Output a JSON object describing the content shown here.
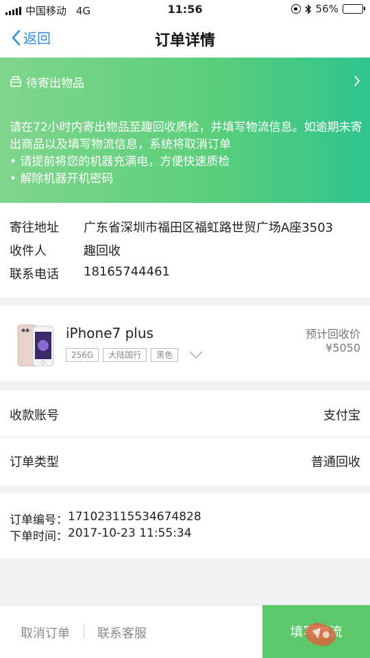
{
  "status_bar": {
    "carrier": "中国移动",
    "network": "4G",
    "time": "11:56",
    "battery": "56%",
    "battery_level": 0.56
  },
  "nav": {
    "back_label": "返回",
    "title": "订单详情"
  },
  "banner": {
    "title": "待寄出物品",
    "notice": "请在72小时内寄出物品至趣回收质检，并填写物流信息。如逾期未寄出商品以及填写物流信息，系统将取消订单",
    "tips": [
      "请提前将您的机器充满电，方便快速质检",
      "解除机器开机密码"
    ]
  },
  "address": {
    "rows": [
      {
        "label": "寄往地址",
        "value": "广东省深圳市福田区福虹路世贸广场A座3503"
      },
      {
        "label": "收件人",
        "value": "趣回收"
      },
      {
        "label": "联系电话",
        "value": "18165744461"
      }
    ]
  },
  "product": {
    "name": "iPhone7 plus",
    "tags": [
      "256G",
      "大陆国行",
      "黑色"
    ],
    "price_label": "预计回收价",
    "price": "¥5050"
  },
  "payment": {
    "label": "收款账号",
    "value": "支付宝"
  },
  "order_type": {
    "label": "订单类型",
    "value": "普通回收"
  },
  "order_info": {
    "number_label": "订单编号：",
    "number": "171023115534674828",
    "time_label": "下单时间：",
    "time": "2017-10-23 11:55:34"
  },
  "bottom_bar": {
    "cancel": "取消订单",
    "contact": "联系客服",
    "fill": "填写物流"
  },
  "colors": {
    "accent": "#2a8df0",
    "banner_start": "#7fd68c",
    "banner_end": "#2fc48e",
    "fill_button": "#5bc86a"
  }
}
